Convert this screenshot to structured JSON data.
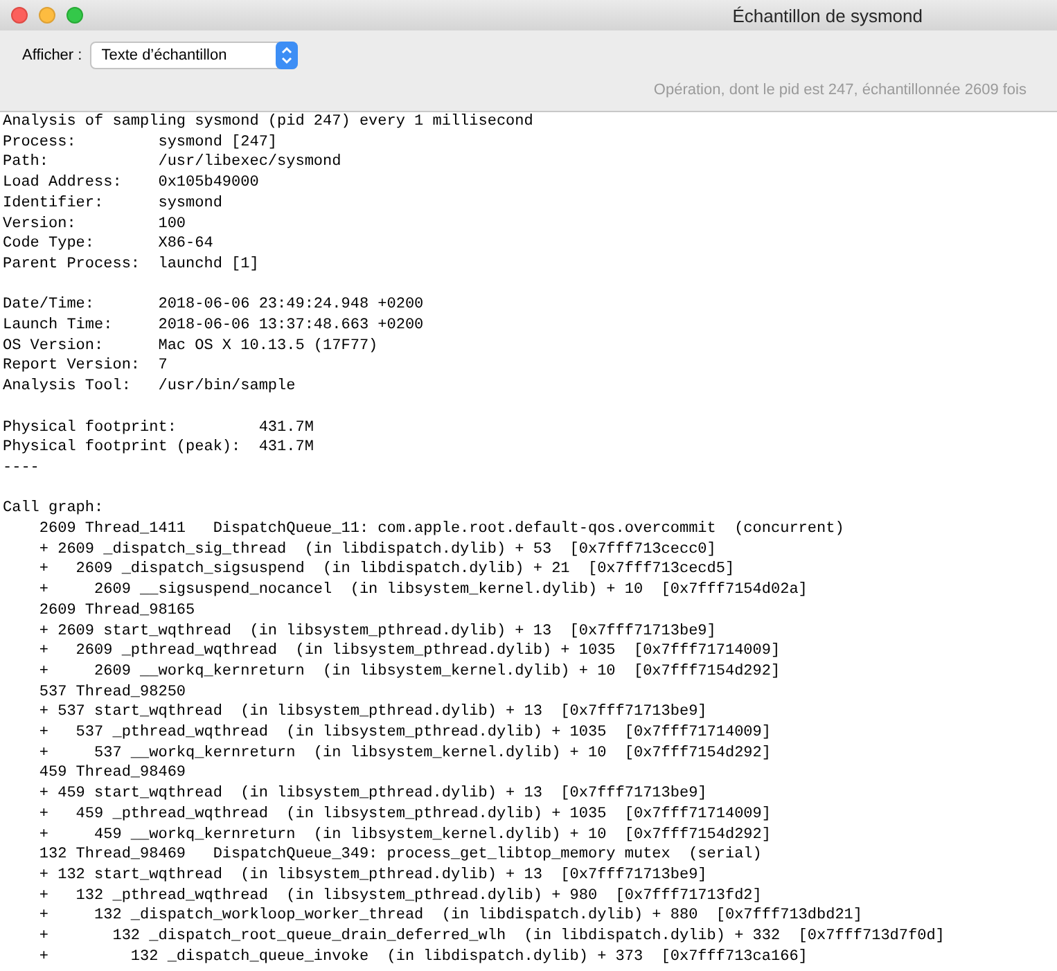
{
  "window": {
    "title": "Échantillon de sysmond"
  },
  "toolbar": {
    "display_label": "Afficher :",
    "display_value": "Texte d’échantillon",
    "status": "Opération, dont le pid est 247, échantillonnée 2609 fois"
  },
  "report": {
    "sections": [
      [
        "Analysis of sampling sysmond (pid 247) every 1 millisecond",
        "Process:         sysmond [247]",
        "Path:            /usr/libexec/sysmond",
        "Load Address:    0x105b49000",
        "Identifier:      sysmond",
        "Version:         100",
        "Code Type:       X86-64",
        "Parent Process:  launchd [1]"
      ],
      [
        "Date/Time:       2018-06-06 23:49:24.948 +0200",
        "Launch Time:     2018-06-06 13:37:48.663 +0200",
        "OS Version:      Mac OS X 10.13.5 (17F77)",
        "Report Version:  7",
        "Analysis Tool:   /usr/bin/sample"
      ],
      [
        "Physical footprint:         431.7M",
        "Physical footprint (peak):  431.7M",
        "----"
      ],
      [
        "Call graph:",
        "    2609 Thread_1411   DispatchQueue_11: com.apple.root.default-qos.overcommit  (concurrent)",
        "    + 2609 _dispatch_sig_thread  (in libdispatch.dylib) + 53  [0x7fff713cecc0]",
        "    +   2609 _dispatch_sigsuspend  (in libdispatch.dylib) + 21  [0x7fff713cecd5]",
        "    +     2609 __sigsuspend_nocancel  (in libsystem_kernel.dylib) + 10  [0x7fff7154d02a]",
        "    2609 Thread_98165",
        "    + 2609 start_wqthread  (in libsystem_pthread.dylib) + 13  [0x7fff71713be9]",
        "    +   2609 _pthread_wqthread  (in libsystem_pthread.dylib) + 1035  [0x7fff71714009]",
        "    +     2609 __workq_kernreturn  (in libsystem_kernel.dylib) + 10  [0x7fff7154d292]",
        "    537 Thread_98250",
        "    + 537 start_wqthread  (in libsystem_pthread.dylib) + 13  [0x7fff71713be9]",
        "    +   537 _pthread_wqthread  (in libsystem_pthread.dylib) + 1035  [0x7fff71714009]",
        "    +     537 __workq_kernreturn  (in libsystem_kernel.dylib) + 10  [0x7fff7154d292]",
        "    459 Thread_98469",
        "    + 459 start_wqthread  (in libsystem_pthread.dylib) + 13  [0x7fff71713be9]",
        "    +   459 _pthread_wqthread  (in libsystem_pthread.dylib) + 1035  [0x7fff71714009]",
        "    +     459 __workq_kernreturn  (in libsystem_kernel.dylib) + 10  [0x7fff7154d292]",
        "    132 Thread_98469   DispatchQueue_349: process_get_libtop_memory mutex  (serial)",
        "    + 132 start_wqthread  (in libsystem_pthread.dylib) + 13  [0x7fff71713be9]",
        "    +   132 _pthread_wqthread  (in libsystem_pthread.dylib) + 980  [0x7fff71713fd2]",
        "    +     132 _dispatch_workloop_worker_thread  (in libdispatch.dylib) + 880  [0x7fff713dbd21]",
        "    +       132 _dispatch_root_queue_drain_deferred_wlh  (in libdispatch.dylib) + 332  [0x7fff713d7f0d]",
        "    +         132 _dispatch_queue_invoke  (in libdispatch.dylib) + 373  [0x7fff713ca166]"
      ]
    ]
  }
}
